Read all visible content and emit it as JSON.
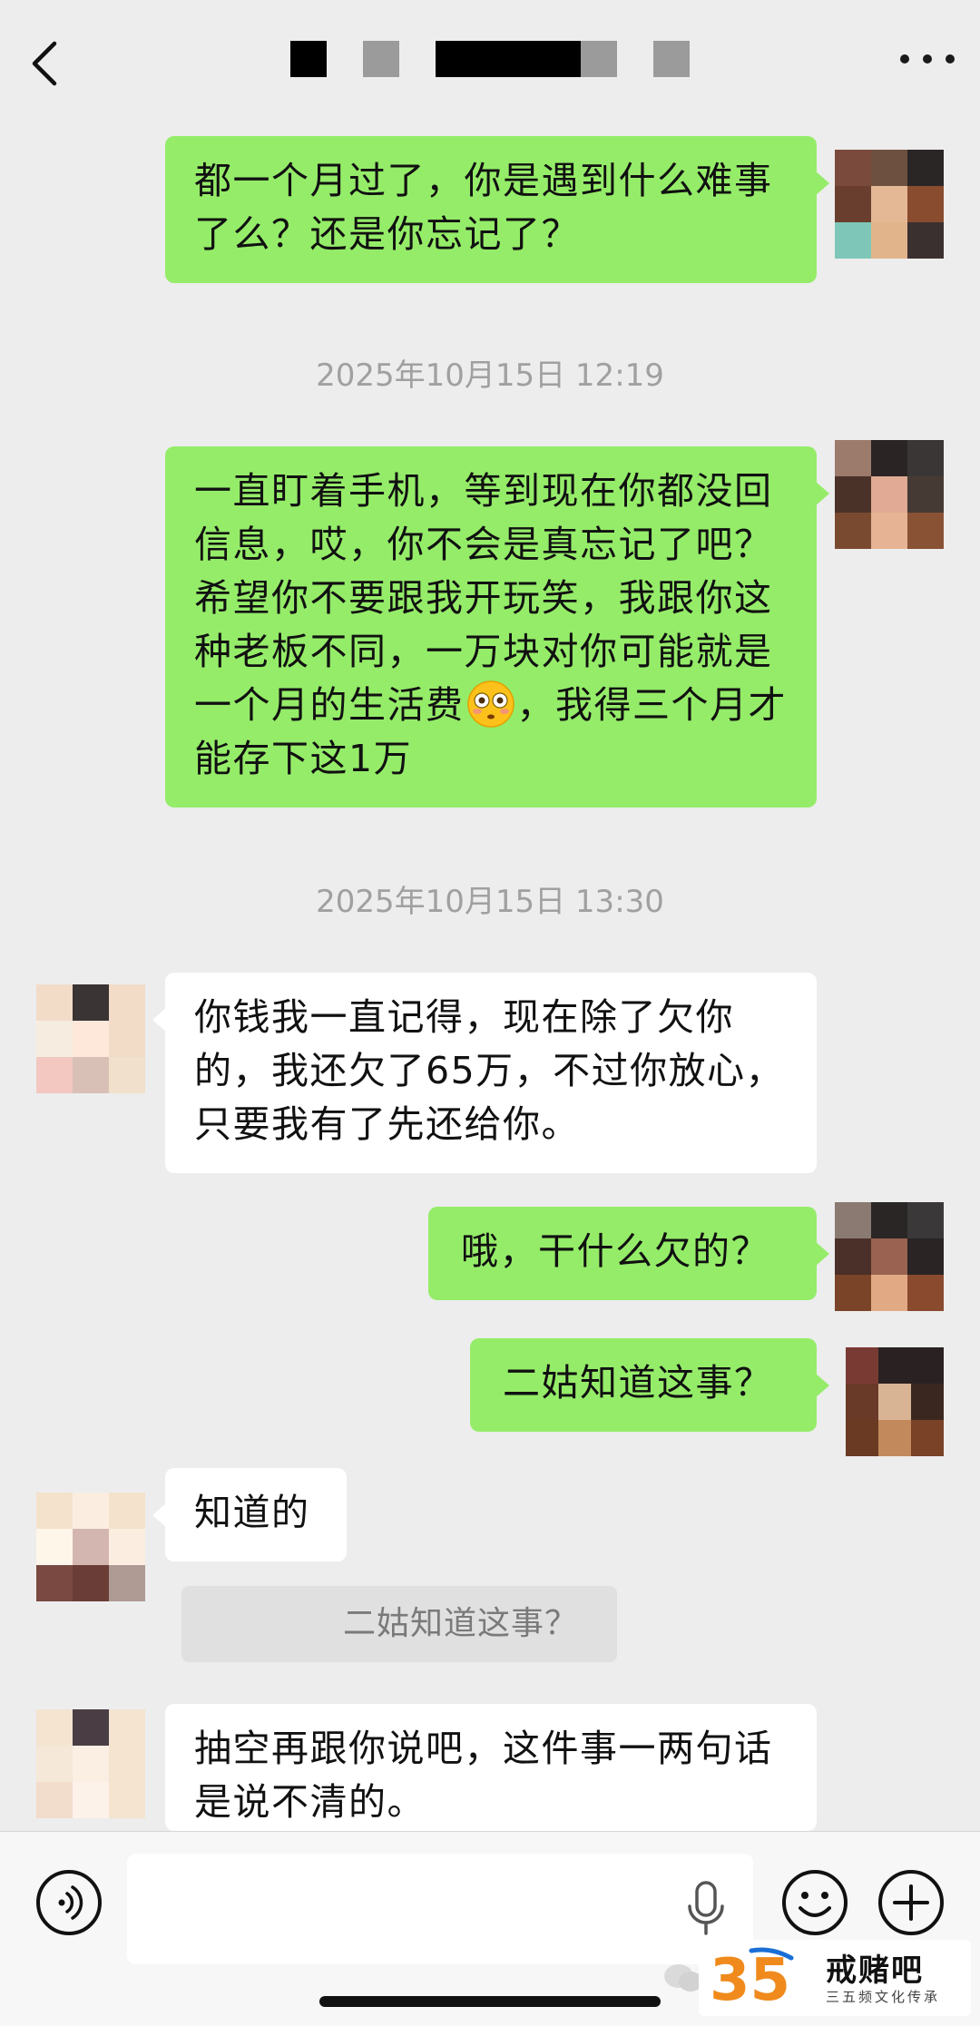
{
  "header": {
    "back_icon": "chevron-left-icon",
    "title_redacted": true,
    "more_icon": "more-dots-icon"
  },
  "messages": [
    {
      "side": "right",
      "text": "都一个月过了，你是遇到什么难事了么？还是你忘记了？"
    },
    {
      "type": "time",
      "text": "2025年10月15日 12:19"
    },
    {
      "side": "right",
      "text_before_emoji": "一直盯着手机，等到现在你都没回信息，哎，你不会是真忘记了吧？希望你不要跟我开玩笑，我跟你这种老板不同，一万块对你可能就是一个月的生活费",
      "emoji": "flushed-face",
      "text_after_emoji": "，我得三个月才能存下这1万"
    },
    {
      "type": "time",
      "text": "2025年10月15日 13:30"
    },
    {
      "side": "left",
      "text": "你钱我一直记得，现在除了欠你的，我还欠了65万，不过你放心，只要我有了先还给你。"
    },
    {
      "side": "right",
      "text": "哦，干什么欠的？"
    },
    {
      "side": "right",
      "text": "二姑知道这事？"
    },
    {
      "side": "left",
      "text": "知道的"
    },
    {
      "type": "quote",
      "text": "二姑知道这事？"
    },
    {
      "side": "left",
      "text": "抽空再跟你说吧，这件事一两句话是说不清的。"
    }
  ],
  "input_bar": {
    "voice_icon": "voice-toggle-icon",
    "input_value": "",
    "mic_icon": "microphone-icon",
    "emoji_icon": "smiley-icon",
    "add_icon": "plus-icon"
  },
  "watermark": {
    "number": "35",
    "name": "戒赌吧",
    "tagline": "三五频文化传承"
  },
  "colors": {
    "background": "#ededed",
    "own_bubble": "#95ec69",
    "other_bubble": "#ffffff",
    "timestamp": "#a0a0a0"
  }
}
